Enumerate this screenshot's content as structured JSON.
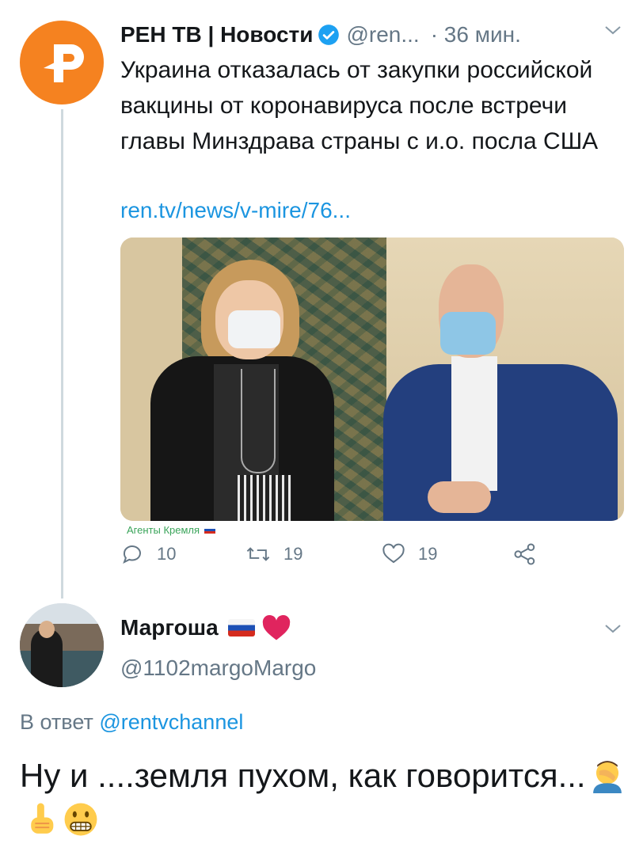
{
  "tweet": {
    "author_name": "РЕН ТВ | Новости",
    "handle": "@ren...",
    "time": "· 36 мин.",
    "text": "Украина отказалась от закупки российской вакцины от коронавируса после встречи главы Минздрава страны с и.о. посла США",
    "link": "ren.tv/news/v-mire/76...",
    "image_watermark": "Агенты Кремля",
    "actions": {
      "replies": "10",
      "retweets": "19",
      "likes": "19"
    },
    "icons": [
      "verified-badge-icon",
      "chevron-down-icon",
      "reply-icon",
      "retweet-icon",
      "like-icon",
      "share-icon"
    ]
  },
  "reply": {
    "author_name": "Маргоша",
    "handle": "@1102margoMargo",
    "reply_to_prefix": "В ответ",
    "reply_to_mention": "@rentvchannel",
    "text": "Ну и ....земля пухом, как говорится...",
    "emojis": [
      "facepalm-emoji",
      "pointing-up-emoji",
      "grimacing-emoji"
    ]
  },
  "colors": {
    "brand_orange": "#f58220",
    "link_blue": "#1b95e0",
    "muted_gray": "#657786",
    "text": "#14171a"
  }
}
